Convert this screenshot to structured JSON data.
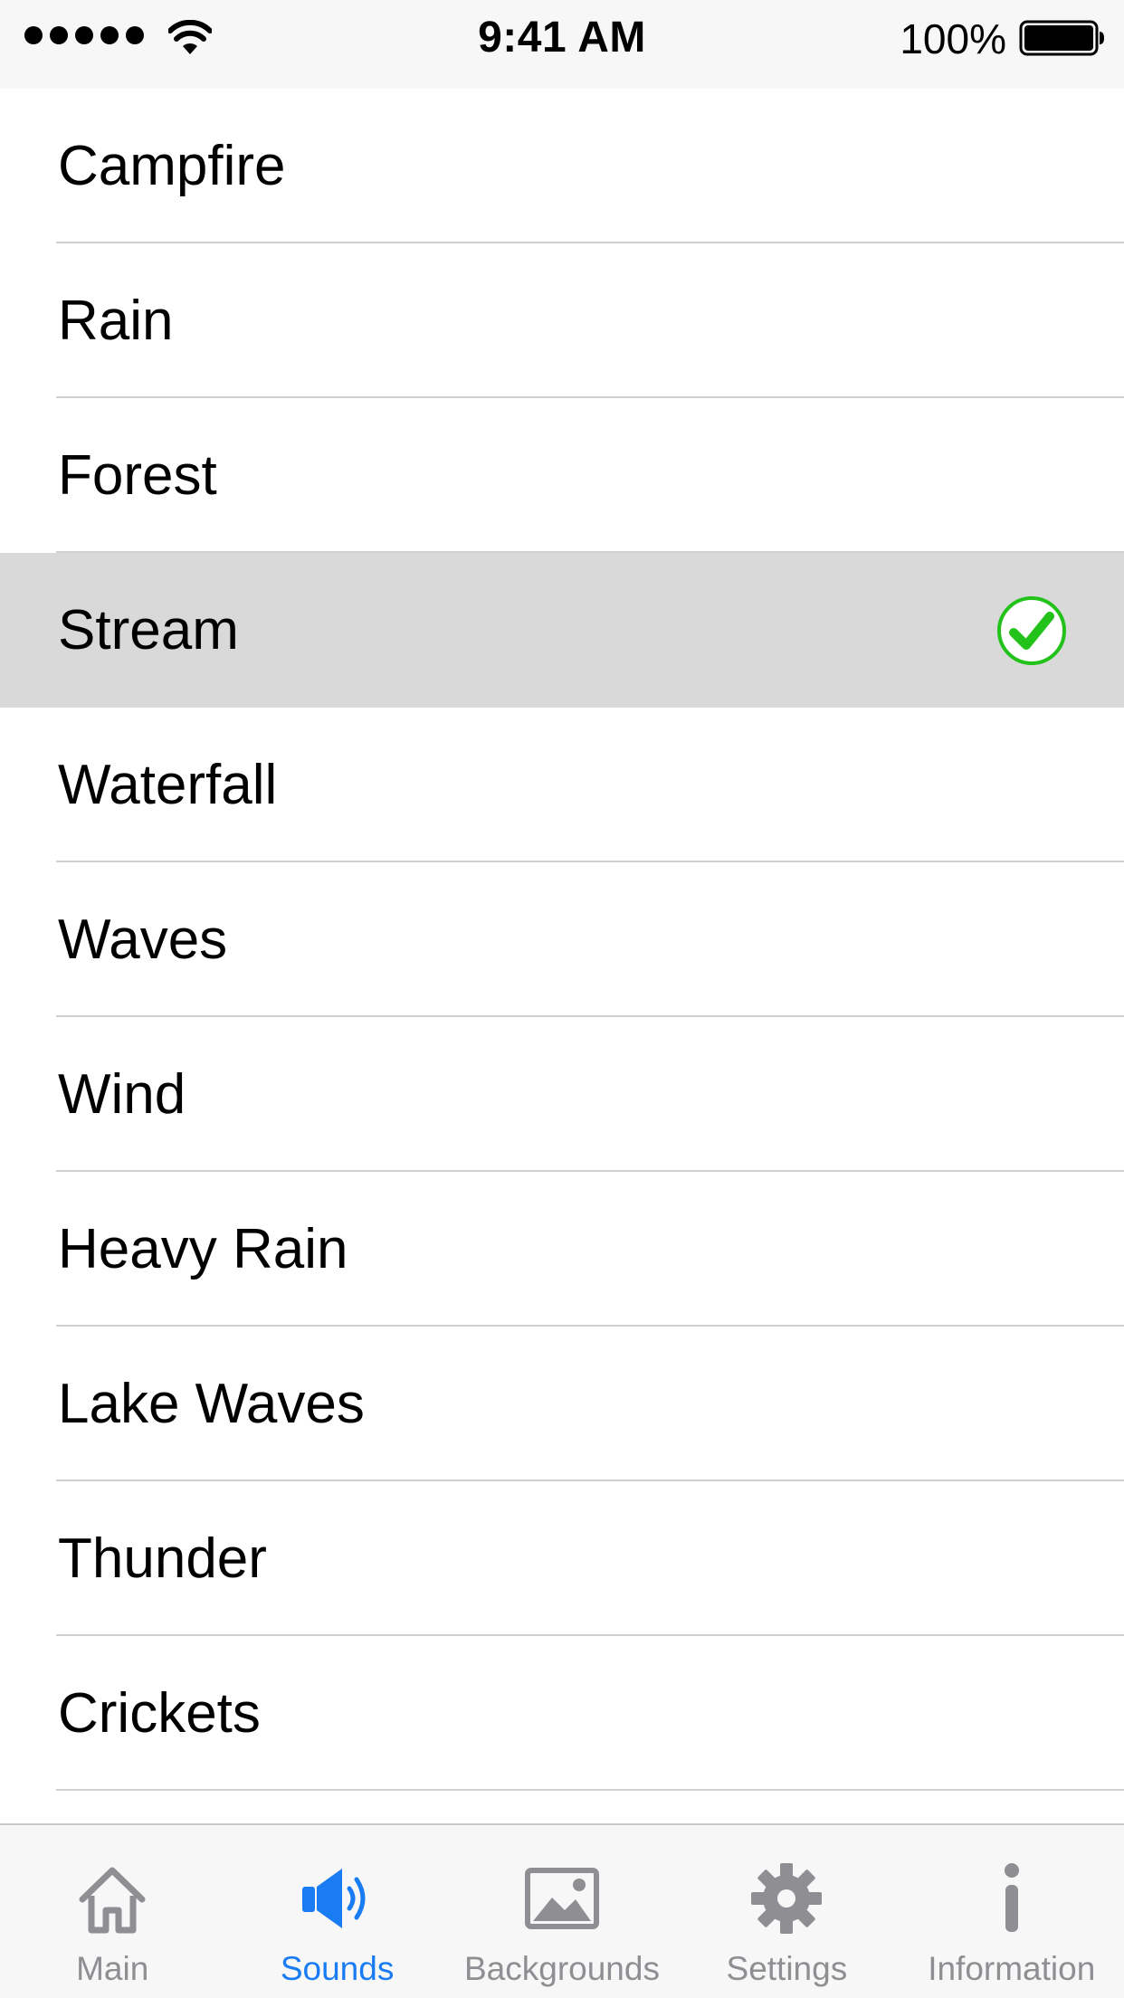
{
  "status_bar": {
    "time": "9:41 AM",
    "battery_percent": "100%",
    "signal_bars": 5,
    "wifi": "wifi-icon",
    "battery": "battery-full-icon"
  },
  "sounds": {
    "selected_index": 3,
    "selected_icon": "checkmark-circle-icon",
    "accent_check_color": "#23c21a",
    "items": [
      {
        "label": "Campfire"
      },
      {
        "label": "Rain"
      },
      {
        "label": "Forest"
      },
      {
        "label": "Stream"
      },
      {
        "label": "Waterfall"
      },
      {
        "label": "Waves"
      },
      {
        "label": "Wind"
      },
      {
        "label": "Heavy Rain"
      },
      {
        "label": "Lake Waves"
      },
      {
        "label": "Thunder"
      },
      {
        "label": "Crickets"
      }
    ]
  },
  "tab_bar": {
    "active_color": "#1a7cf2",
    "inactive_color": "#8e8e93",
    "tabs": [
      {
        "label": "Main",
        "icon": "home-icon",
        "active": false
      },
      {
        "label": "Sounds",
        "icon": "speaker-icon",
        "active": true
      },
      {
        "label": "Backgrounds",
        "icon": "image-icon",
        "active": false
      },
      {
        "label": "Settings",
        "icon": "gear-icon",
        "active": false
      },
      {
        "label": "Information",
        "icon": "info-icon",
        "active": false
      }
    ]
  }
}
